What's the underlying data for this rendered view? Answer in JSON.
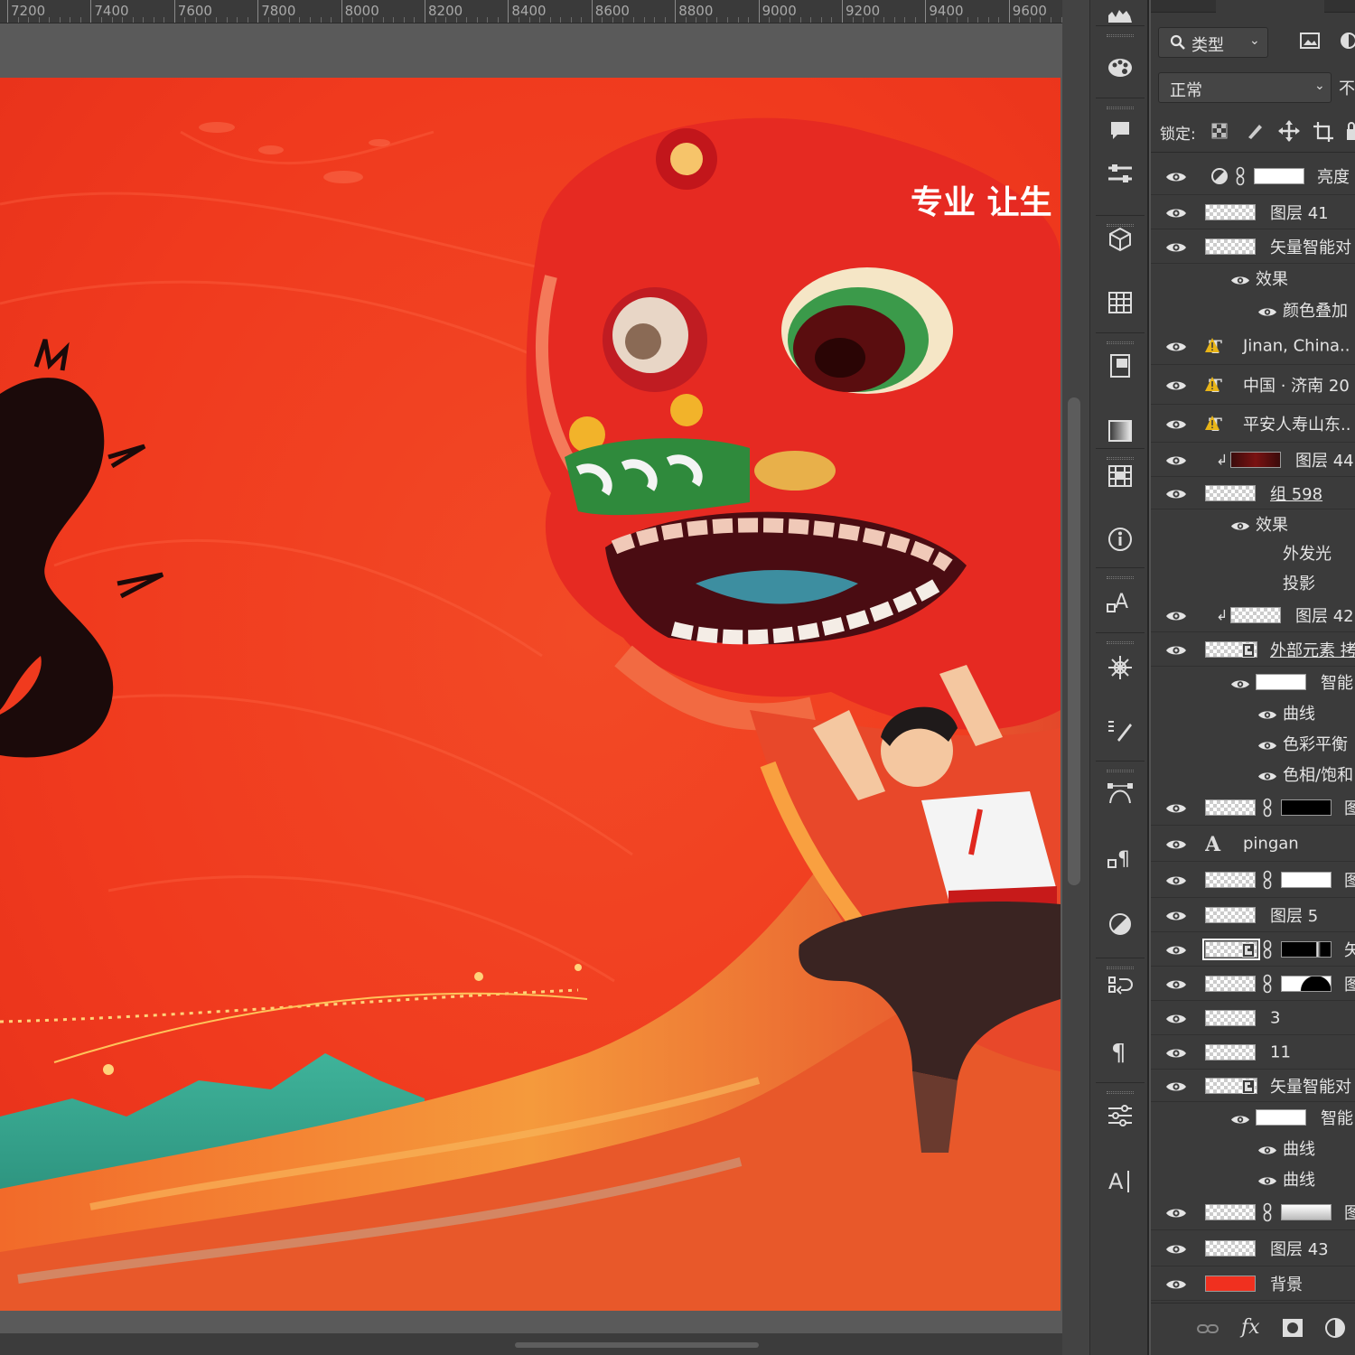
{
  "ruler": {
    "labels": [
      "7200",
      "7400",
      "7600",
      "7800",
      "8000",
      "8200",
      "8400",
      "8600",
      "8800",
      "9000",
      "9200",
      "9400",
      "9600"
    ]
  },
  "artwork": {
    "overlay_text": "专业 让生"
  },
  "tools": [
    "histogram-icon",
    "color-palette-icon",
    "comment-icon",
    "adjustments-icon",
    "3d-cube-icon",
    "grid-table-icon",
    "artboard-icon",
    "gradient-icon",
    "channels-icon",
    "info-icon",
    "character-style-icon",
    "brush-settings-icon",
    "brush-presets-icon",
    "path-icon",
    "paragraph-style-icon",
    "adjustment-layer-icon",
    "history-icon",
    "paragraph-icon",
    "properties-icon",
    "type-icon"
  ],
  "layers_panel": {
    "filter_label": "类型",
    "blend_mode": "正常",
    "opacity_label_partial": "不",
    "lock_label": "锁定:",
    "layers": [
      {
        "label": "亮度",
        "type": "adjustment"
      },
      {
        "label": "图层 41",
        "type": "pixel"
      },
      {
        "label": "矢量智能对",
        "type": "pixel"
      },
      {
        "label": "效果",
        "type": "effects-header"
      },
      {
        "label": "颜色叠加",
        "type": "effect"
      },
      {
        "label": "Jinan, China..",
        "type": "text-warning"
      },
      {
        "label": "中国 · 济南 20",
        "type": "text-warning"
      },
      {
        "label": "平安人寿山东..",
        "type": "text-warning"
      },
      {
        "label": "图层 44",
        "type": "clipped-dark"
      },
      {
        "label": "组 598",
        "type": "group"
      },
      {
        "label": "效果",
        "type": "effects-header"
      },
      {
        "label": "外发光",
        "type": "effect-noeye"
      },
      {
        "label": "投影",
        "type": "effect-noeye"
      },
      {
        "label": "图层 42",
        "type": "clipped"
      },
      {
        "label": "外部元素 拷",
        "type": "smart"
      },
      {
        "label": "智能",
        "type": "smart-filter"
      },
      {
        "label": "曲线",
        "type": "filter"
      },
      {
        "label": "色彩平衡",
        "type": "filter"
      },
      {
        "label": "色相/饱和",
        "type": "filter"
      },
      {
        "label": "图",
        "type": "masked-black"
      },
      {
        "label": "pingan",
        "type": "text"
      },
      {
        "label": "图",
        "type": "masked-white"
      },
      {
        "label": "图层 5",
        "type": "pixel"
      },
      {
        "label": "矢",
        "type": "smart-masked"
      },
      {
        "label": "图",
        "type": "masked-shape"
      },
      {
        "label": "3",
        "type": "pixel"
      },
      {
        "label": "11",
        "type": "pixel"
      },
      {
        "label": "矢量智能对",
        "type": "smart"
      },
      {
        "label": "智能",
        "type": "smart-filter"
      },
      {
        "label": "曲线",
        "type": "filter"
      },
      {
        "label": "曲线",
        "type": "filter"
      },
      {
        "label": "图",
        "type": "masked-gradient"
      },
      {
        "label": "图层 43",
        "type": "pixel"
      },
      {
        "label": "背景",
        "type": "background"
      }
    ]
  },
  "colors": {
    "art_red": "#f23a1f",
    "panel_bg": "#3b3b3b",
    "warning_yellow": "#e8b417"
  }
}
